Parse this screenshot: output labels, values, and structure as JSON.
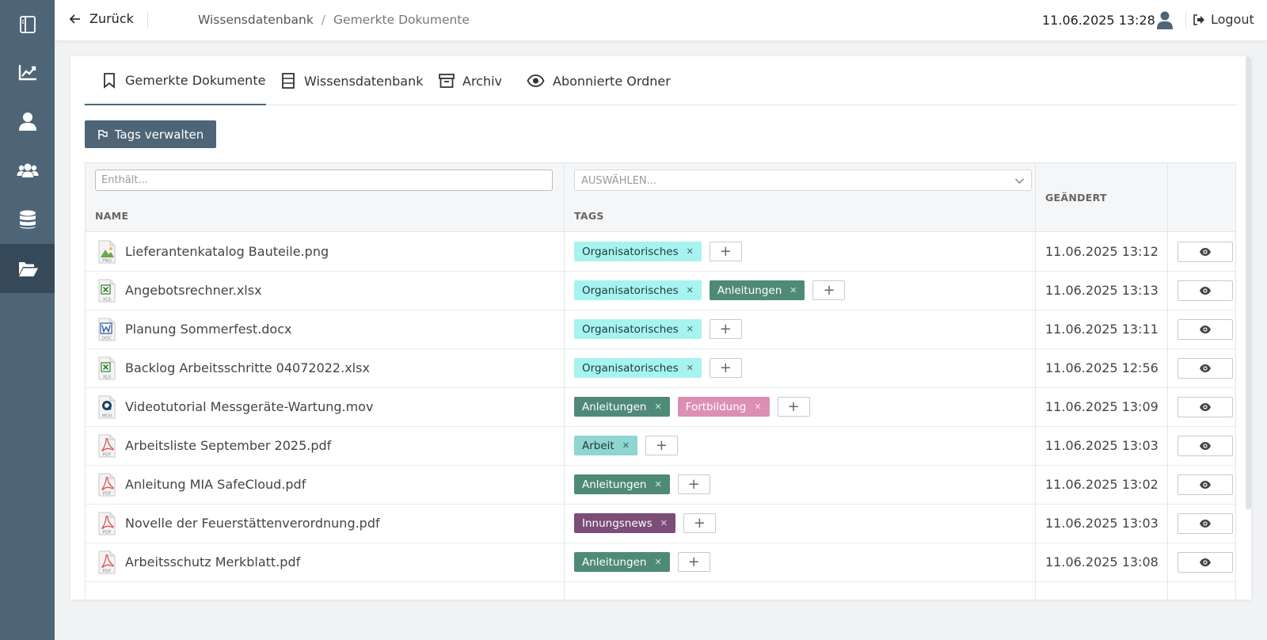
{
  "header": {
    "back_label": "Zurück",
    "breadcrumb": {
      "parent": "Wissensdatenbank",
      "separator": "/",
      "current": "Gemerkte Dokumente"
    },
    "datetime": "11.06.2025 13:28",
    "logout_label": "Logout"
  },
  "sidebar": {
    "items": [
      {
        "icon": "sidebar-toggle-icon"
      },
      {
        "icon": "chart-icon"
      },
      {
        "icon": "user-icon"
      },
      {
        "icon": "users-icon"
      },
      {
        "icon": "database-icon"
      },
      {
        "icon": "folder-open-icon",
        "active": true
      }
    ]
  },
  "tabs": [
    {
      "label": "Gemerkte Dokumente",
      "icon": "bookmark-icon",
      "active": true
    },
    {
      "label": "Wissensdatenbank",
      "icon": "document-list-icon"
    },
    {
      "label": "Archiv",
      "icon": "archive-icon"
    },
    {
      "label": "Abonnierte Ordner",
      "icon": "eye-icon"
    }
  ],
  "actions": {
    "manage_tags_label": "Tags verwalten"
  },
  "table": {
    "filter_placeholder": "Enthält...",
    "select_placeholder": "AUSWÄHLEN...",
    "columns": {
      "name": "NAME",
      "tags": "TAGS",
      "changed": "GEÄNDERT"
    },
    "rows": [
      {
        "name": "Lieferantenkatalog Bauteile.png",
        "type": "PNG",
        "tags": [
          "Organisatorisches"
        ],
        "changed": "11.06.2025 13:12"
      },
      {
        "name": "Angebotsrechner.xlsx",
        "type": "XLS",
        "tags": [
          "Organisatorisches",
          "Anleitungen"
        ],
        "changed": "11.06.2025 13:13"
      },
      {
        "name": "Planung Sommerfest.docx",
        "type": "DOC",
        "tags": [
          "Organisatorisches"
        ],
        "changed": "11.06.2025 13:11"
      },
      {
        "name": "Backlog Arbeitsschritte 04072022.xlsx",
        "type": "XLS",
        "tags": [
          "Organisatorisches"
        ],
        "changed": "11.06.2025 12:56"
      },
      {
        "name": "Videotutorial Messgeräte-Wartung.mov",
        "type": "MOV",
        "tags": [
          "Anleitungen",
          "Fortbildung"
        ],
        "changed": "11.06.2025 13:09"
      },
      {
        "name": "Arbeitsliste September 2025.pdf",
        "type": "PDF",
        "tags": [
          "Arbeit"
        ],
        "changed": "11.06.2025 13:03"
      },
      {
        "name": "Anleitung MIA SafeCloud.pdf",
        "type": "PDF",
        "tags": [
          "Anleitungen"
        ],
        "changed": "11.06.2025 13:02"
      },
      {
        "name": "Novelle der Feuerstättenverordnung.pdf",
        "type": "PDF",
        "tags": [
          "Innungsnews"
        ],
        "changed": "11.06.2025 13:03"
      },
      {
        "name": "Arbeitsschutz Merkblatt.pdf",
        "type": "PDF",
        "tags": [
          "Anleitungen"
        ],
        "changed": "11.06.2025 13:08"
      }
    ]
  },
  "tag_colors": {
    "Organisatorisches": {
      "bg": "#a6f3ef",
      "fg": "#1f3b3b"
    },
    "Anleitungen": {
      "bg": "#4f8a78",
      "fg": "#ffffff"
    },
    "Fortbildung": {
      "bg": "#dc8fb4",
      "fg": "#ffffff"
    },
    "Arbeit": {
      "bg": "#8fd5d2",
      "fg": "#1f3b3b"
    },
    "Innungsnews": {
      "bg": "#7b4d78",
      "fg": "#ffffff"
    }
  },
  "file_type_colors": {
    "PNG": "#6aa84f",
    "XLS": "#2e7d32",
    "DOC": "#2b579a",
    "MOV": "#1c3f5e",
    "PDF": "#d9534f"
  },
  "colors": {
    "sidebar": "#4d6577",
    "sidebar_active": "#364959",
    "primary_button": "#4d6577"
  }
}
